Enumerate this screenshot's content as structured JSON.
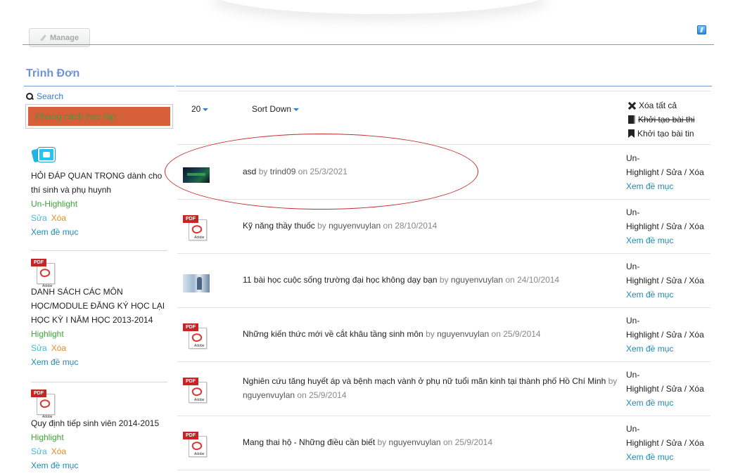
{
  "header": {
    "manage_label": "Manage"
  },
  "sidebar": {
    "title": "Trình Đơn",
    "search_label": "Search",
    "style_label": "Phong cách học tập",
    "items": [
      {
        "title": "HỎI ĐÁP QUAN TRỌNG dành cho thí sinh và phụ huynh",
        "highlight": "Un-Highlight",
        "edit": "Sửa",
        "delete": "Xóa",
        "view": "Xem đề mục",
        "icon": "folder-photo-icon"
      },
      {
        "title": "DANH SÁCH CÁC MÔN HỌC/MODULE ĐĂNG KÝ HỌC LẠI HỌC KỲ I NĂM HỌC 2013-2014",
        "highlight": "Highlight",
        "edit": "Sửa",
        "delete": "Xóa",
        "view": "Xem đề mục",
        "icon": "pdf-icon"
      },
      {
        "title": "Quy định tiếp sinh viên 2014-2015",
        "highlight": "Highlight",
        "edit": "Sửa",
        "delete": "Xóa",
        "view": "Xem đề mục",
        "icon": "pdf-icon"
      }
    ]
  },
  "toolbar": {
    "page_size": "20",
    "sort_label": "Sort Down",
    "delete_all": "Xóa tất cả",
    "create_exam": "Khởi tạo bài thi",
    "create_news": "Khởi tạo bài tin"
  },
  "rows": [
    {
      "title": "asd",
      "by": "by",
      "author": "trind09",
      "on": "on",
      "date": "25/3/2021",
      "actions_line1": "Un-",
      "actions_line2": "Highlight / Sửa / Xóa",
      "view": "Xem đề mục",
      "thumb": "dark-image-thumb"
    },
    {
      "title": "Kỹ năng thầy thuốc",
      "by": "by",
      "author": "nguyenvuylan",
      "on": "on",
      "date": "28/10/2014",
      "actions_line1": "Un-",
      "actions_line2": "Highlight / Sửa / Xóa",
      "view": "Xem đề mục",
      "thumb": "pdf-icon"
    },
    {
      "title": "11 bài học cuộc sống trường đại học không dạy bạn",
      "by": "by",
      "author": "nguyenvuylan",
      "on": "on",
      "date": "24/10/2014",
      "actions_line1": "Un-",
      "actions_line2": "Highlight / Sửa / Xóa",
      "view": "Xem đề mục",
      "thumb": "photo-thumb"
    },
    {
      "title": "Những kiến thức mới về cắt khâu tầng sinh môn",
      "by": "by",
      "author": "nguyenvuylan",
      "on": "on",
      "date": "25/9/2014",
      "actions_line1": "Un-",
      "actions_line2": "Highlight / Sửa / Xóa",
      "view": "Xem đề mục",
      "thumb": "pdf-icon"
    },
    {
      "title": "Nghiên cứu tăng huyết áp và bệnh mạch vành ở phụ nữ tuổi mãn kinh tại thành phố Hồ Chí Minh",
      "by": "by",
      "author": "nguyenvuylan",
      "on": "on",
      "date": "25/9/2014",
      "actions_line1": "Un-",
      "actions_line2": "Highlight / Sửa / Xóa",
      "view": "Xem đề mục",
      "thumb": "pdf-icon"
    },
    {
      "title": "Mang thai hộ - Những điều cần biết",
      "by": "by",
      "author": "nguyenvuylan",
      "on": "on",
      "date": "25/9/2014",
      "actions_line1": "Un-",
      "actions_line2": "Highlight / Sửa / Xóa",
      "view": "Xem đề mục",
      "thumb": "pdf-icon"
    }
  ],
  "icons": {
    "pdf_band": "PDF",
    "pdf_brand": "Adobe"
  },
  "colors": {
    "accent_line": "#7e98d8",
    "menu_title": "#6f93d8",
    "style_box": "#d65f3a",
    "highlight_green": "#3ea33a",
    "link_blue": "#1f8bb0",
    "annotation_red": "#c62828"
  }
}
